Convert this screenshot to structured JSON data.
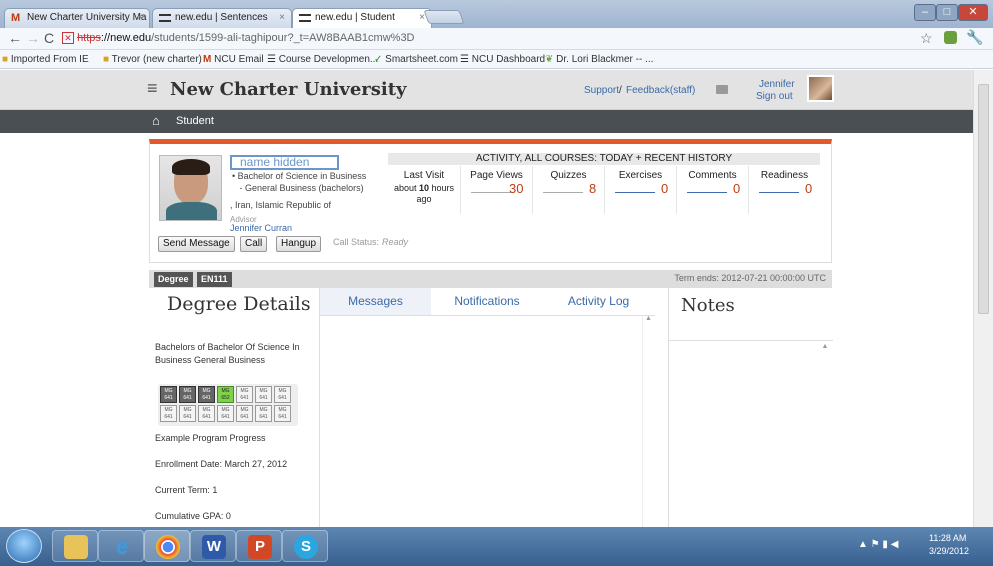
{
  "browser": {
    "tabs": [
      {
        "label": "New Charter University Ma",
        "close": "×"
      },
      {
        "label": "new.edu | Sentences",
        "close": "×"
      },
      {
        "label": "new.edu | Student",
        "close": "×"
      }
    ],
    "url_scheme": "https",
    "url_host": "://new.edu",
    "url_path": "/students/1599-ali-taghipour?_t=AW8BAAB1cmw%3D",
    "bookmarks": [
      "Imported From IE",
      "Trevor (new charter)",
      "NCU Email",
      "Course Developmen...",
      "Smartsheet.com",
      "NCU Dashboard",
      "Dr. Lori Blackmer -- ..."
    ]
  },
  "app": {
    "brand": "New Charter University",
    "support": "Support",
    "feedback": "Feedback(staff)",
    "separator": "/",
    "user_name": "Jennifer",
    "sign_out": "Sign out",
    "nav_student": "Student"
  },
  "student": {
    "name": "name hidden",
    "degree_line1": "Bachelor of Science in Business",
    "degree_line2": "- General Business (bachelors)",
    "location": ", Iran, Islamic Republic of",
    "advisor_label": "Advisor",
    "advisor_name": "Jennifer Curran",
    "send_message": "Send Message",
    "call": "Call",
    "hangup": "Hangup",
    "call_status_label": "Call Status:",
    "call_status": "Ready"
  },
  "activity": {
    "header": "ACTIVITY, ALL COURSES: TODAY + RECENT HISTORY",
    "last_visit_label": "Last Visit",
    "last_visit_prefix": "about",
    "last_visit_num": "10",
    "last_visit_unit": "hours",
    "last_visit_suffix": "ago",
    "columns": [
      {
        "label": "Page Views",
        "value": "30"
      },
      {
        "label": "Quizzes",
        "value": "8"
      },
      {
        "label": "Exercises",
        "value": "0"
      },
      {
        "label": "Comments",
        "value": "0"
      },
      {
        "label": "Readiness",
        "value": "0"
      }
    ]
  },
  "panel": {
    "degree_pill": "Degree",
    "course_pill": "EN111",
    "term_ends": "Term ends: 2012-07-21 00:00:00 UTC"
  },
  "degree": {
    "title": "Degree Details",
    "program": "Bachelors of Bachelor Of Science In Business General Business",
    "courses_row1": [
      "MG 641",
      "MG 641",
      "MG 641",
      "MG 652",
      "MG 641",
      "MG 641",
      "MG 641"
    ],
    "courses_row2": [
      "MG 641",
      "MG 641",
      "MG 641",
      "MG 641",
      "MG 641",
      "MG 641",
      "MG 641"
    ],
    "progress_label": "Example Program Progress",
    "enrollment": "Enrollment Date: March 27, 2012",
    "term": "Current Term: 1",
    "gpa": "Cumulative GPA: 0"
  },
  "tabs": {
    "messages": "Messages",
    "notifications": "Notifications",
    "activity_log": "Activity Log"
  },
  "notes": {
    "title": "Notes"
  },
  "taskbar": {
    "time": "11:28 AM",
    "date": "3/29/2012"
  },
  "colors": {
    "accent": "#e05a2b",
    "link": "#3a6aa8",
    "value": "#c23b10",
    "nav_dark": "#4a4f54"
  }
}
